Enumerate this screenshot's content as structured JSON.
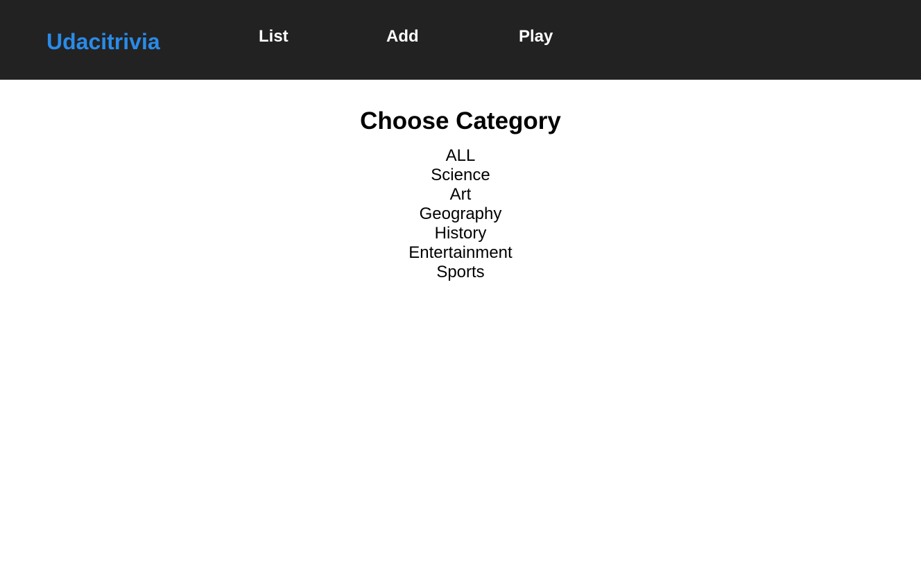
{
  "header": {
    "logo": "Udacitrivia",
    "nav": {
      "list": "List",
      "add": "Add",
      "play": "Play"
    }
  },
  "main": {
    "title": "Choose Category",
    "categories": [
      "ALL",
      "Science",
      "Art",
      "Geography",
      "History",
      "Entertainment",
      "Sports"
    ]
  },
  "colors": {
    "header_background": "#222222",
    "logo": "#2a8be8",
    "nav_text": "#ffffff",
    "body_text": "#000000"
  }
}
